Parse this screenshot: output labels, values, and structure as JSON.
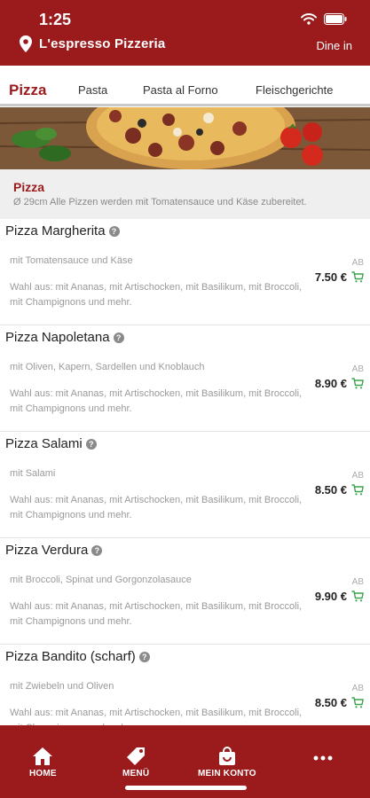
{
  "status": {
    "time": "1:25"
  },
  "header": {
    "title": "L'espresso Pizzeria",
    "mode": "Dine in"
  },
  "tabs": [
    "Pizza",
    "Pasta",
    "Pasta al Forno",
    "Fleischgerichte"
  ],
  "section": {
    "title": "Pizza",
    "description": "Ø 29cm Alle Pizzen werden mit Tomatensauce und Käse zubereitet."
  },
  "items": [
    {
      "name": "Pizza Margherita",
      "sub": "mit Tomatensauce und Käse",
      "options": "Wahl aus: mit Ananas, mit Artischocken, mit Basilikum, mit Broccoli, mit Champignons und mehr.",
      "ab": "AB",
      "price": "7.50 €"
    },
    {
      "name": "Pizza Napoletana",
      "sub": "mit Oliven, Kapern, Sardellen und Knoblauch",
      "options": "Wahl aus: mit Ananas, mit Artischocken, mit Basilikum, mit Broccoli, mit Champignons und mehr.",
      "ab": "AB",
      "price": "8.90 €"
    },
    {
      "name": "Pizza Salami",
      "sub": "mit Salami",
      "options": "Wahl aus: mit Ananas, mit Artischocken, mit Basilikum, mit Broccoli, mit Champignons und mehr.",
      "ab": "AB",
      "price": "8.50 €"
    },
    {
      "name": "Pizza Verdura",
      "sub": "mit Broccoli, Spinat und Gorgonzolasauce",
      "options": "Wahl aus: mit Ananas, mit Artischocken, mit Basilikum, mit Broccoli, mit Champignons und mehr.",
      "ab": "AB",
      "price": "9.90 €"
    },
    {
      "name": "Pizza Bandito (scharf)",
      "sub": "mit Zwiebeln und Oliven",
      "options": "Wahl aus: mit Ananas, mit Artischocken, mit Basilikum, mit Broccoli, mit Champignons und mehr.",
      "ab": "AB",
      "price": "8.50 €"
    }
  ],
  "bottom_nav": [
    "HOME",
    "MENÜ",
    "MEIN KONTO"
  ],
  "colors": {
    "brand": "#9b1a1c",
    "cart": "#3aa34a"
  }
}
